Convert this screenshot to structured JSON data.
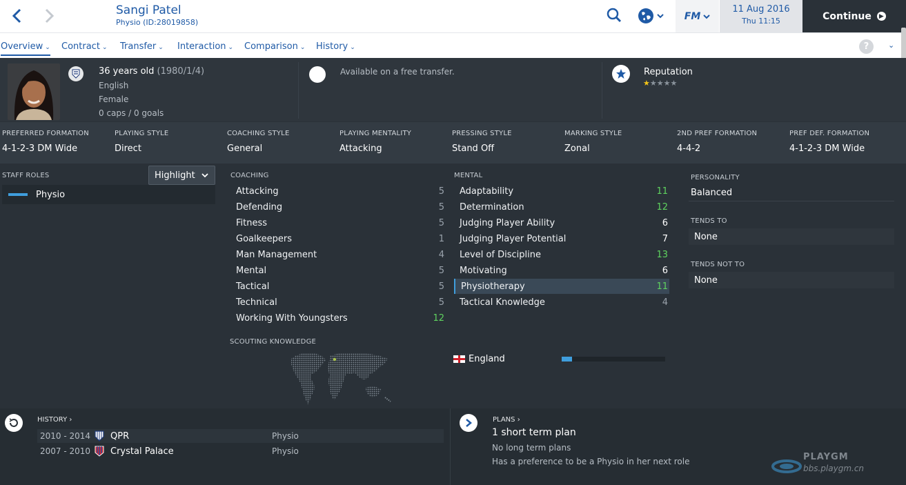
{
  "header": {
    "name": "Sangi Patel",
    "subtitle": "Physio (ID:28019858)",
    "date_line1": "11 Aug 2016",
    "date_line2": "Thu 11:15",
    "continue_label": "Continue",
    "fm_label": "FM"
  },
  "tabs": [
    {
      "label": "Overview"
    },
    {
      "label": "Contract"
    },
    {
      "label": "Transfer"
    },
    {
      "label": "Interaction"
    },
    {
      "label": "Comparison"
    },
    {
      "label": "History"
    }
  ],
  "profile": {
    "age": "36 years old",
    "dob": "(1980/1/4)",
    "nationality": "English",
    "gender": "Female",
    "caps": "0 caps / 0 goals",
    "transfer_status": "Available on a free transfer.",
    "reputation_label": "Reputation",
    "reputation_stars": 1,
    "reputation_max": 5
  },
  "styles": [
    {
      "label": "PREFERRED FORMATION",
      "value": "4-1-2-3 DM Wide"
    },
    {
      "label": "PLAYING STYLE",
      "value": "Direct"
    },
    {
      "label": "COACHING STYLE",
      "value": "General"
    },
    {
      "label": "PLAYING MENTALITY",
      "value": "Attacking"
    },
    {
      "label": "PRESSING STYLE",
      "value": "Stand Off"
    },
    {
      "label": "MARKING STYLE",
      "value": "Zonal"
    },
    {
      "label": "2ND PREF FORMATION",
      "value": "4-4-2"
    },
    {
      "label": "PREF DEF. FORMATION",
      "value": "4-1-2-3 DM Wide"
    }
  ],
  "staff_roles": {
    "title": "STAFF ROLES",
    "highlight_label": "Highlight",
    "roles": [
      "Physio"
    ]
  },
  "coaching": {
    "title": "COACHING",
    "attributes": [
      {
        "name": "Attacking",
        "value": "5"
      },
      {
        "name": "Defending",
        "value": "5"
      },
      {
        "name": "Fitness",
        "value": "5"
      },
      {
        "name": "Goalkeepers",
        "value": "1"
      },
      {
        "name": "Man Management",
        "value": "4"
      },
      {
        "name": "Mental",
        "value": "5"
      },
      {
        "name": "Tactical",
        "value": "5"
      },
      {
        "name": "Technical",
        "value": "5"
      },
      {
        "name": "Working With Youngsters",
        "value": "12"
      }
    ]
  },
  "mental": {
    "title": "MENTAL",
    "attributes": [
      {
        "name": "Adaptability",
        "value": "11"
      },
      {
        "name": "Determination",
        "value": "12"
      },
      {
        "name": "Judging Player Ability",
        "value": "6"
      },
      {
        "name": "Judging Player Potential",
        "value": "7"
      },
      {
        "name": "Level of Discipline",
        "value": "13"
      },
      {
        "name": "Motivating",
        "value": "6"
      },
      {
        "name": "Physiotherapy",
        "value": "11"
      },
      {
        "name": "Tactical Knowledge",
        "value": "4"
      }
    ]
  },
  "personality": {
    "personality_title": "PERSONALITY",
    "personality_value": "Balanced",
    "tends_to_title": "TENDS TO",
    "tends_to_value": "None",
    "tends_not_to_title": "TENDS NOT TO",
    "tends_not_to_value": "None"
  },
  "scouting": {
    "title": "SCOUTING KNOWLEDGE",
    "nations": [
      {
        "name": "England",
        "knowledge_fraction": 0.1
      }
    ]
  },
  "history": {
    "title": "HISTORY",
    "rows": [
      {
        "years": "2010 - 2014",
        "club": "QPR",
        "role": "Physio"
      },
      {
        "years": "2007 - 2010",
        "club": "Crystal Palace",
        "role": "Physio"
      }
    ]
  },
  "plans": {
    "title": "PLANS",
    "main": "1 short term plan",
    "line2": "No long term plans",
    "line3": "Has a preference to be a Physio in her next role"
  },
  "watermark": {
    "line1": "PLAYGM",
    "line2": "bbs.playgm.cn"
  },
  "colors": {
    "accent": "#1f5aa6",
    "highlight_bar": "#3f9edd",
    "good_attr": "#5fd35f",
    "star": "#f5c518"
  }
}
